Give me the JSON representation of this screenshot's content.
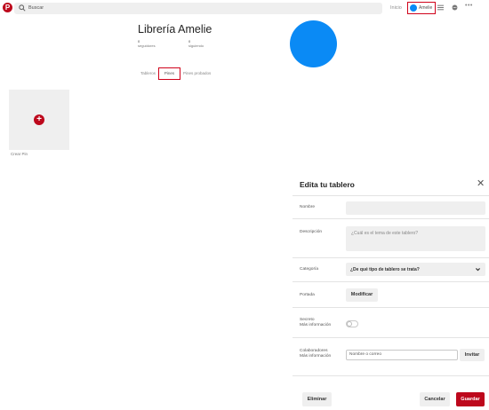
{
  "header": {
    "logo_glyph": "P",
    "search_placeholder": "Buscar",
    "nav_home": "Inicio",
    "nav_user": "Amelie",
    "more_glyph": "•••"
  },
  "profile": {
    "name": "Librería Amelie",
    "followers_count": "0",
    "followers_label": "seguidores",
    "following_count": "0",
    "following_label": "siguiendo",
    "tabs": [
      "Tableros",
      "Pines",
      "Pines probados"
    ]
  },
  "pin": {
    "plus_glyph": "+",
    "create_label": "Crear Pin"
  },
  "edit_board": {
    "title": "Edita tu tablero",
    "close_glyph": "✕",
    "name_label": "Nombre",
    "description_label": "Descripción",
    "description_placeholder": "¿Cuál es el tema de este tablero?",
    "category_label": "Categoría",
    "category_value": "¿De qué tipo de tablero se trata?",
    "cover_label": "Portada",
    "cover_button": "Modificar",
    "secret_label": "Secreto",
    "secret_more": "Más información",
    "secret_on": false,
    "collab_label": "Colaboradores",
    "collab_more": "Más información",
    "collab_placeholder": "Nombre o correo",
    "invite_button": "Invitar",
    "delete_button": "Eliminar",
    "cancel_button": "Cancelar",
    "save_button": "Guardar"
  },
  "colors": {
    "brand_red": "#bd081c",
    "avatar_blue": "#0a8af5",
    "highlight_red": "#d0021b"
  },
  "icons": [
    "pinterest-logo-icon",
    "search-icon",
    "hamburger-menu-icon",
    "chat-bubble-icon",
    "more-dots-icon",
    "add-icon",
    "close-icon",
    "chevron-down-icon"
  ]
}
